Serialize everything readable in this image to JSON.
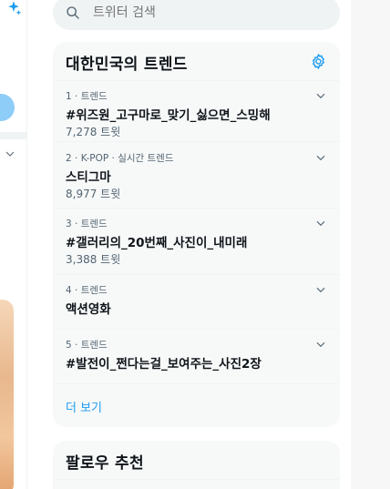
{
  "search": {
    "placeholder": "트위터 검색"
  },
  "trends": {
    "title": "대한민국의 트렌드",
    "items": [
      {
        "meta": "1 · 트렌드",
        "title": "#위즈원_고구마로_맞기_싫으면_스밍해",
        "count": "7,278 트윗"
      },
      {
        "meta": "2 · K-POP · 실시간 트렌드",
        "title": "스티그마",
        "count": "8,977 트윗"
      },
      {
        "meta": "3 · 트렌드",
        "title": "#갤러리의_20번째_사진이_내미래",
        "count": "3,388 트윗"
      },
      {
        "meta": "4 · 트렌드",
        "title": "액션영화",
        "count": ""
      },
      {
        "meta": "5 · 트렌드",
        "title": "#발전이_쩐다는걸_보여주는_사진2장",
        "count": ""
      }
    ],
    "show_more": "더 보기"
  },
  "follow": {
    "title": "팔로우 추천"
  },
  "colors": {
    "accent": "#1d9bf0",
    "panel_bg": "#f7f9f9",
    "muted_text": "#536471"
  }
}
